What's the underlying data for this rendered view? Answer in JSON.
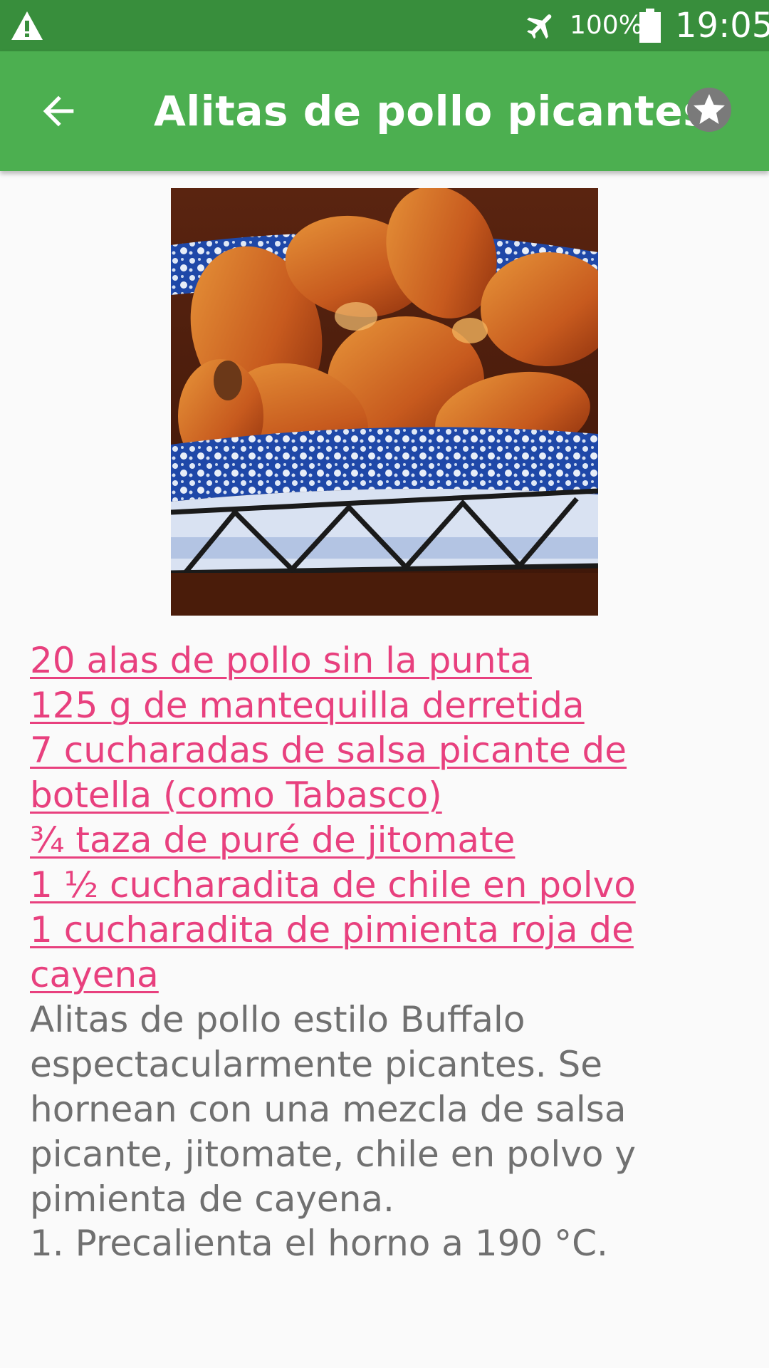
{
  "status_bar": {
    "battery_percent": "100%",
    "time": "19:05",
    "icons": [
      "warning-icon",
      "airplane-mode-icon",
      "battery-icon"
    ]
  },
  "toolbar": {
    "title": "Alitas de pollo picantes",
    "back_icon": "arrow-back-icon",
    "favorite_icon": "star-icon"
  },
  "colors": {
    "status_bar": "#388e3c",
    "toolbar": "#4caf50",
    "ingredient_link": "#e8407e",
    "body_text": "#707070",
    "background": "#fafafa"
  },
  "ingredients": [
    "20 alas de pollo sin la punta",
    "125 g de mantequilla derretida",
    "7 cucharadas de salsa picante de botella (como Tabasco)",
    "¾ taza de puré de jitomate",
    "1 ½ cucharadita de chile en polvo",
    "1 cucharadita de pimienta roja de cayena"
  ],
  "description": "Alitas de pollo estilo Buffalo espectacularmente picantes. Se hornean con una mezcla de salsa picante, jitomate, chile en polvo y pimienta de cayena.",
  "steps": [
    "1. Precalienta el horno a 190 °C."
  ]
}
